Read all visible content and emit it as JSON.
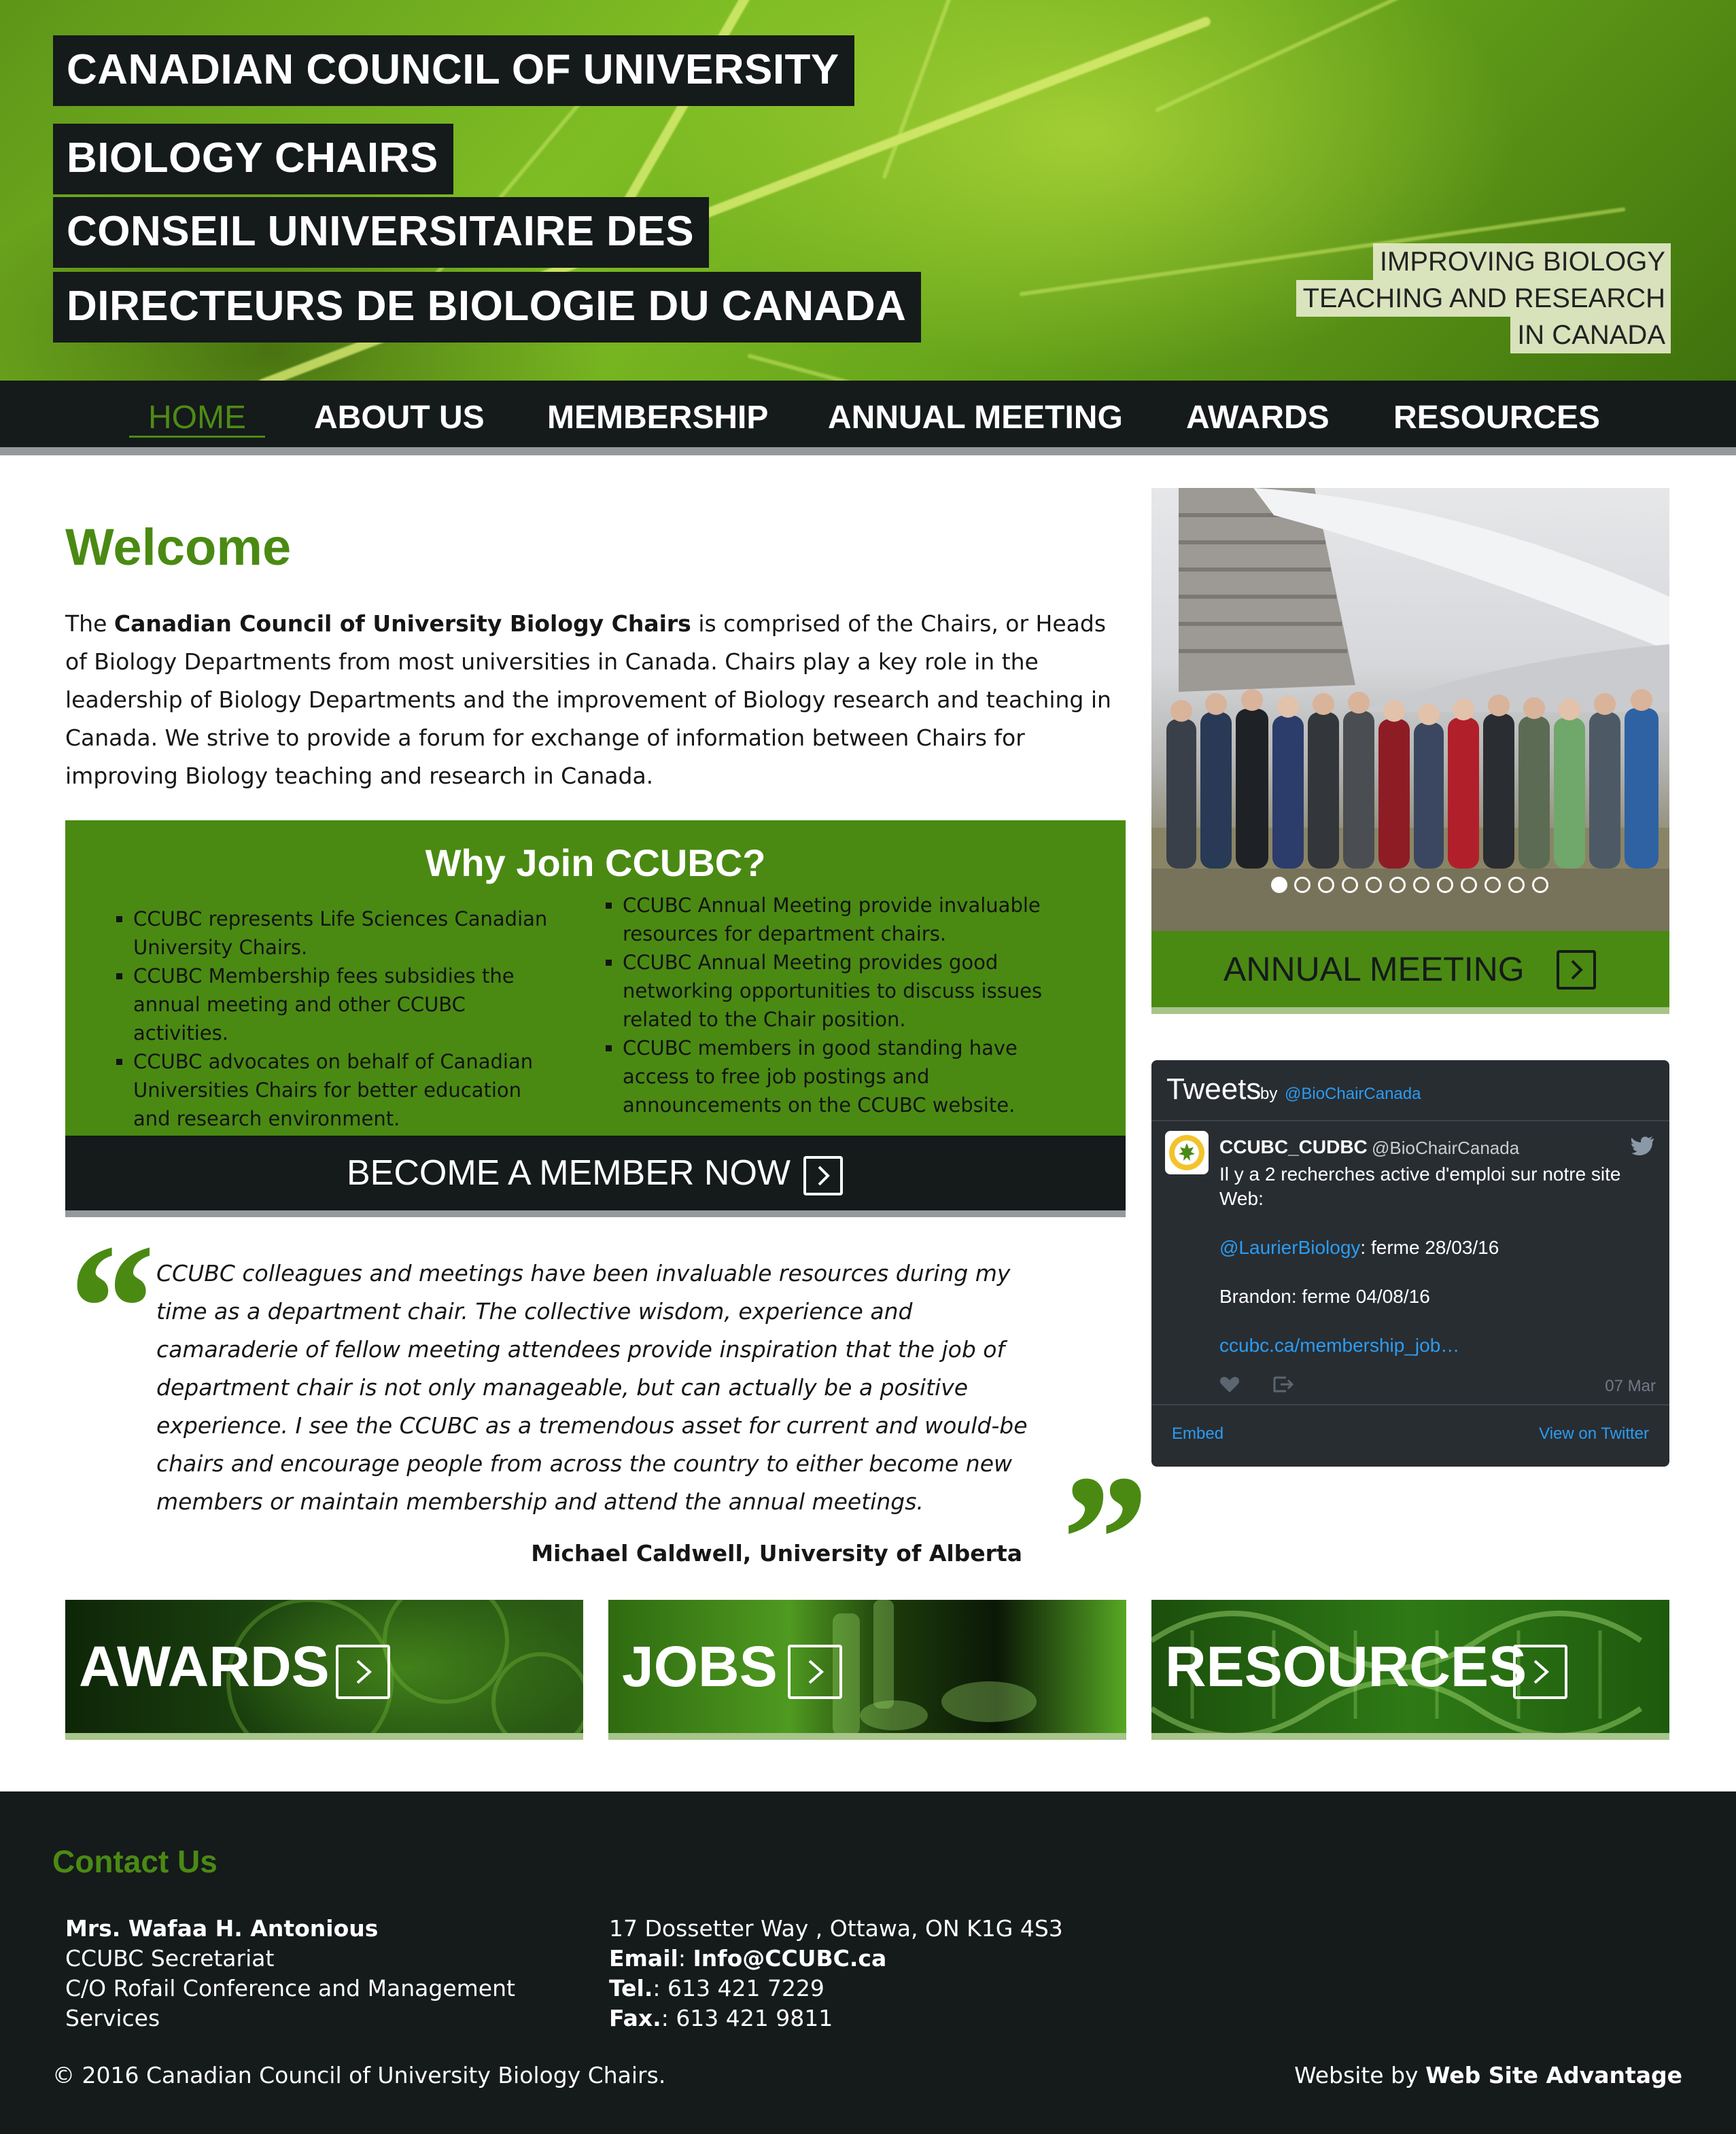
{
  "colors": {
    "brand_green": "#4a8a13",
    "dark": "#151a1b",
    "accent_light": "#a7c48a",
    "twitter_link": "#2b9cf2"
  },
  "header": {
    "title_lines": [
      "CANADIAN COUNCIL OF UNIVERSITY",
      "BIOLOGY CHAIRS",
      "CONSEIL UNIVERSITAIRE DES",
      "DIRECTEURS DE BIOLOGIE DU CANADA"
    ],
    "tagline_lines": [
      "IMPROVING BIOLOGY",
      "TEACHING AND RESEARCH",
      "IN CANADA"
    ]
  },
  "nav": {
    "items": [
      "HOME",
      "ABOUT US",
      "MEMBERSHIP",
      "ANNUAL MEETING",
      "AWARDS",
      "RESOURCES"
    ],
    "active": "HOME"
  },
  "welcome": {
    "title": "Welcome",
    "intro_prefix": "The ",
    "org_name": "Canadian Council of University Biology Chairs",
    "intro_body": " is comprised of the Chairs, or Heads of Biology Departments from most universities in Canada. Chairs play a key role in the leadership of Biology Departments and the improvement of Biology research and teaching in Canada. We strive to provide a forum for exchange of information between Chairs for improving Biology teaching and research in Canada."
  },
  "why_join": {
    "title": "Why Join CCUBC?",
    "left_items": [
      "CCUBC represents Life Sciences Canadian University Chairs.",
      "CCUBC Membership fees subsidies the annual meeting and other CCUBC activities.",
      "CCUBC advocates on behalf of Canadian Universities Chairs for better education and research environment."
    ],
    "right_items": [
      "CCUBC Annual Meeting provide invaluable resources for department chairs.",
      "CCUBC Annual Meeting provides good networking opportunities to discuss issues related to the Chair position.",
      "CCUBC members in good standing have access to free job postings and announcements on the CCUBC website."
    ],
    "cta_label": "BECOME A MEMBER NOW"
  },
  "testimonial": {
    "open_mark": "“",
    "close_mark": "”",
    "text": "CCUBC colleagues and meetings have been invaluable resources during my time as a department chair. The collective wisdom, experience and camaraderie of fellow meeting attendees provide inspiration that the job of department chair is not only manageable, but can actually be a positive experience. I see the CCUBC as a tremendous asset for current and would-be chairs and encourage people from across the country to either become new members or maintain membership and attend the annual meetings.",
    "author": "Michael Caldwell, University of Alberta"
  },
  "slider": {
    "slide_count": 12,
    "active_slide": 1,
    "caption": "ANNUAL MEETING"
  },
  "twitter": {
    "title": "Tweets",
    "by_label": "by",
    "handle": "@BioChairCanada",
    "tweet": {
      "name": "CCUBC_CUDBC",
      "handle": "@BioChairCanada",
      "text_line1": "Il y a 2 recherches active d'emploi sur notre site Web:",
      "mention": "@LaurierBiology",
      "mention_rest": ": ferme 28/03/16",
      "line3": "Brandon: ferme 04/08/16",
      "link": "ccubc.ca/membership_job…",
      "date": "07 Mar"
    },
    "embed_label": "Embed",
    "view_label": "View on Twitter"
  },
  "tiles": [
    "AWARDS",
    "JOBS",
    "RESOURCES"
  ],
  "footer": {
    "contact_title": "Contact Us",
    "contact_name": "Mrs. Wafaa H. Antonious",
    "left_lines": [
      "CCUBC Secretariat",
      "C/O Rofail Conference and Management",
      "Services"
    ],
    "address": "17 Dossetter Way , Ottawa, ON K1G 4S3",
    "email_label": "Email",
    "email": "Info@CCUBC.ca",
    "tel_label": "Tel.",
    "tel": "613 421 7229",
    "fax_label": "Fax.",
    "fax": "613 421 9811",
    "copyright": "© 2016 Canadian Council of University Biology Chairs.",
    "credit_prefix": "Website by ",
    "credit_name": "Web Site Advantage"
  }
}
